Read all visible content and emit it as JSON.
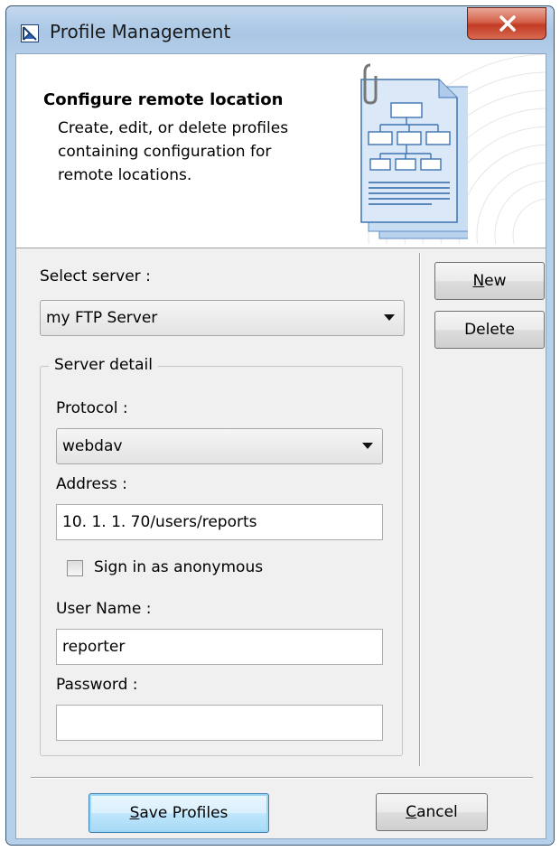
{
  "window": {
    "title": "Profile Management"
  },
  "banner": {
    "title": "Configure remote location",
    "description_lines": [
      "Create, edit, or delete profiles",
      "containing configuration for",
      "remote locations."
    ]
  },
  "server": {
    "label": "Select server :",
    "selected": "my FTP Server"
  },
  "buttons": {
    "new": {
      "mnemonic": "N",
      "rest": "ew"
    },
    "delete": "Delete",
    "save": {
      "mnemonic": "S",
      "rest": "ave Profiles"
    },
    "cancel": {
      "mnemonic": "C",
      "rest": "ancel"
    }
  },
  "detail": {
    "legend": "Server detail",
    "protocol_label": "Protocol :",
    "protocol_value": "webdav",
    "address_label": "Address :",
    "address_value": "10. 1. 1. 70/users/reports",
    "anonymous_label": "Sign in as anonymous",
    "anonymous_checked": false,
    "username_label": "User Name :",
    "username_value": "reporter",
    "password_label": "Password :",
    "password_value": ""
  },
  "colors": {
    "titlebar": "#b7d0ea",
    "close": "#c23a23",
    "default_button": "#3c7fb1"
  }
}
